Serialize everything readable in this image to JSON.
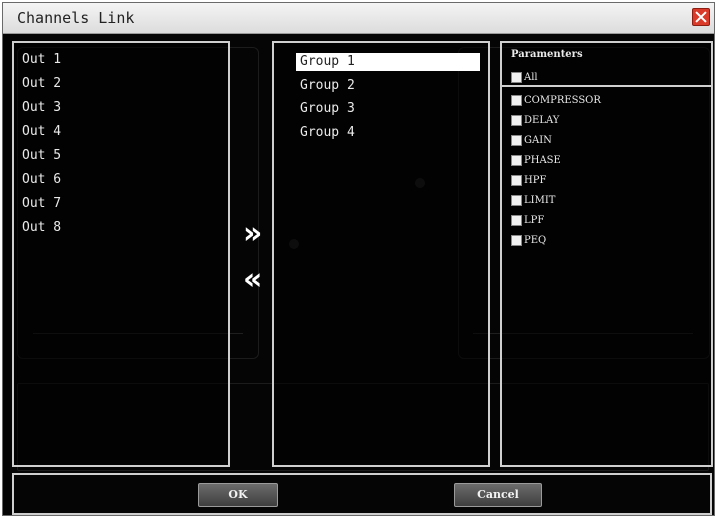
{
  "window": {
    "title": "Channels Link"
  },
  "outputs": [
    "Out 1",
    "Out 2",
    "Out 3",
    "Out 4",
    "Out 5",
    "Out 6",
    "Out 7",
    "Out 8"
  ],
  "groups": [
    {
      "label": "Group 1",
      "selected": true
    },
    {
      "label": "Group 2",
      "selected": false
    },
    {
      "label": "Group 3",
      "selected": false
    },
    {
      "label": "Group 4",
      "selected": false
    }
  ],
  "transfer": {
    "add_symbol": "»",
    "remove_symbol": "«"
  },
  "parameters": {
    "heading": "Paramenters",
    "all_label": "All",
    "items": [
      "COMPRESSOR",
      "DELAY",
      "GAIN",
      "PHASE",
      "HPF",
      "LIMIT",
      "LPF",
      "PEQ"
    ]
  },
  "footer": {
    "ok_label": "OK",
    "cancel_label": "Cancel"
  },
  "colors": {
    "background": "#050505",
    "panel_border": "#cfcfcf",
    "selection": "#ffffff",
    "close_button": "#d93a2a"
  }
}
